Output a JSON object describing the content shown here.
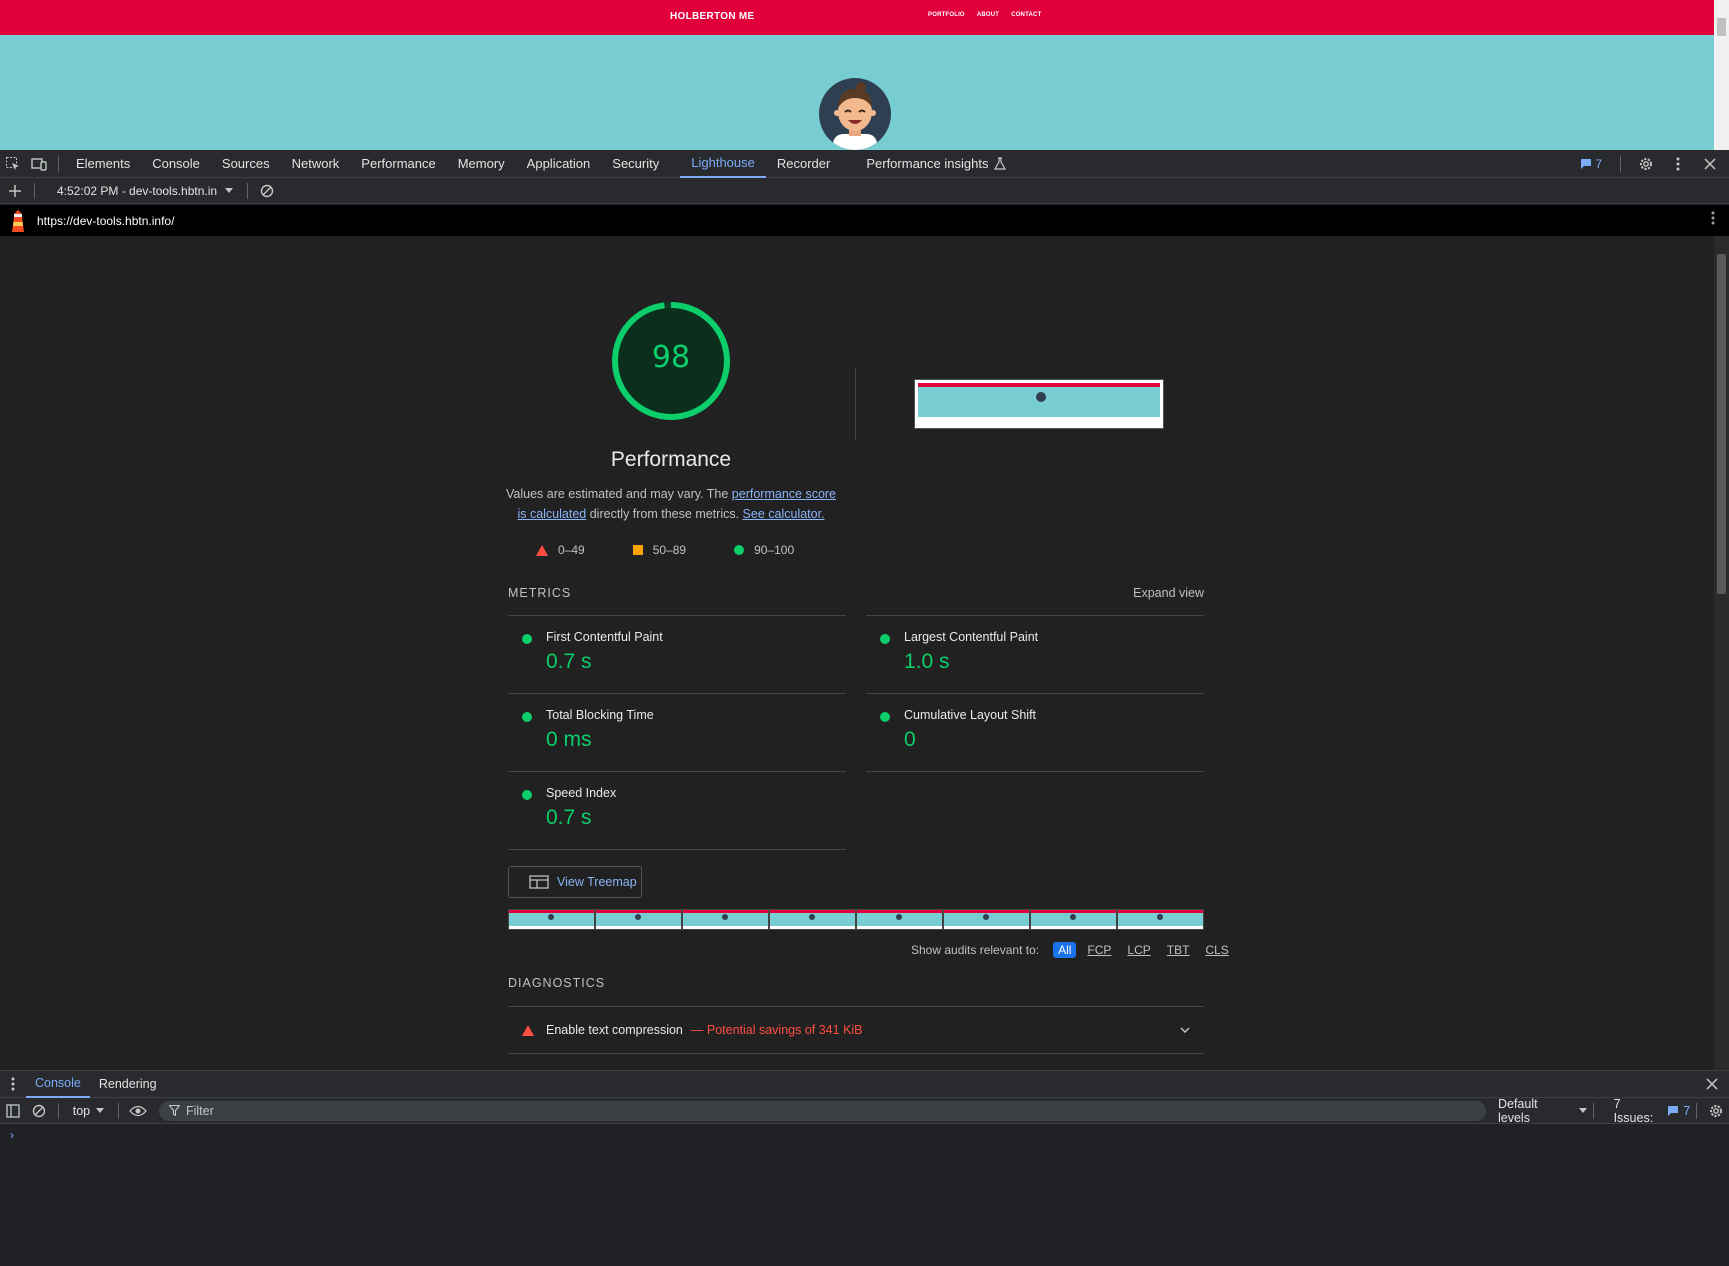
{
  "site": {
    "brand": "HOLBERTON ME",
    "nav": [
      "PORTFOLIO",
      "ABOUT",
      "CONTACT"
    ]
  },
  "devtools": {
    "tabs": [
      "Elements",
      "Console",
      "Sources",
      "Network",
      "Performance",
      "Memory",
      "Application",
      "Security",
      "Lighthouse",
      "Recorder",
      "Performance insights"
    ],
    "active_tab": "Lighthouse",
    "issues_count": "7"
  },
  "lighthouse": {
    "report_select": "4:52:02 PM - dev-tools.hbtn.in",
    "url": "https://dev-tools.hbtn.info/",
    "score": "98",
    "score_fraction": 0.98,
    "category_title": "Performance",
    "desc_prefix": "Values are estimated and may vary. The ",
    "desc_link1": "performance score is calculated",
    "desc_middle": " directly from these metrics. ",
    "desc_link2": "See calculator.",
    "legend": [
      "0–49",
      "50–89",
      "90–100"
    ],
    "metrics_label": "METRICS",
    "expand_view": "Expand view",
    "metrics": [
      {
        "name": "First Contentful Paint",
        "value": "0.7 s"
      },
      {
        "name": "Largest Contentful Paint",
        "value": "1.0 s"
      },
      {
        "name": "Total Blocking Time",
        "value": "0 ms"
      },
      {
        "name": "Cumulative Layout Shift",
        "value": "0"
      },
      {
        "name": "Speed Index",
        "value": "0.7 s"
      }
    ],
    "treemap_button": "View Treemap",
    "audit_filter_label": "Show audits relevant to:",
    "audit_filters": [
      "All",
      "FCP",
      "LCP",
      "TBT",
      "CLS"
    ],
    "diagnostics_label": "DIAGNOSTICS",
    "audit": {
      "title": "Enable text compression",
      "savings": "— Potential savings of 341 KiB"
    },
    "colors": {
      "pass": "#0cce6b",
      "average": "#ffa400",
      "fail": "#ff4e42"
    }
  },
  "drawer": {
    "tabs": [
      "Console",
      "Rendering"
    ],
    "active_tab": "Console",
    "context": "top",
    "filter_placeholder": "Filter",
    "levels": "Default levels",
    "issues_label": "7 Issues:",
    "issues_count": "7"
  }
}
